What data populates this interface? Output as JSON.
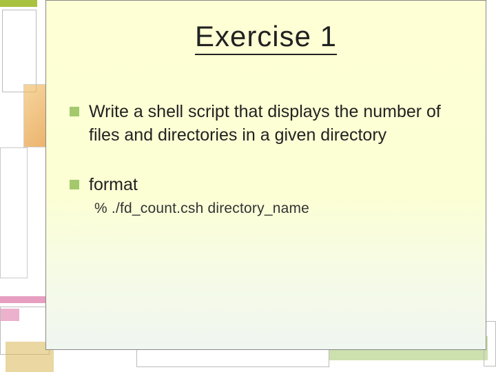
{
  "title": "Exercise 1",
  "bullets": {
    "0": {
      "text": "Write a shell script that displays the number of files and directories in a given directory"
    },
    "1": {
      "text": "format",
      "sub": "% ./fd_count.csh directory_name"
    }
  }
}
